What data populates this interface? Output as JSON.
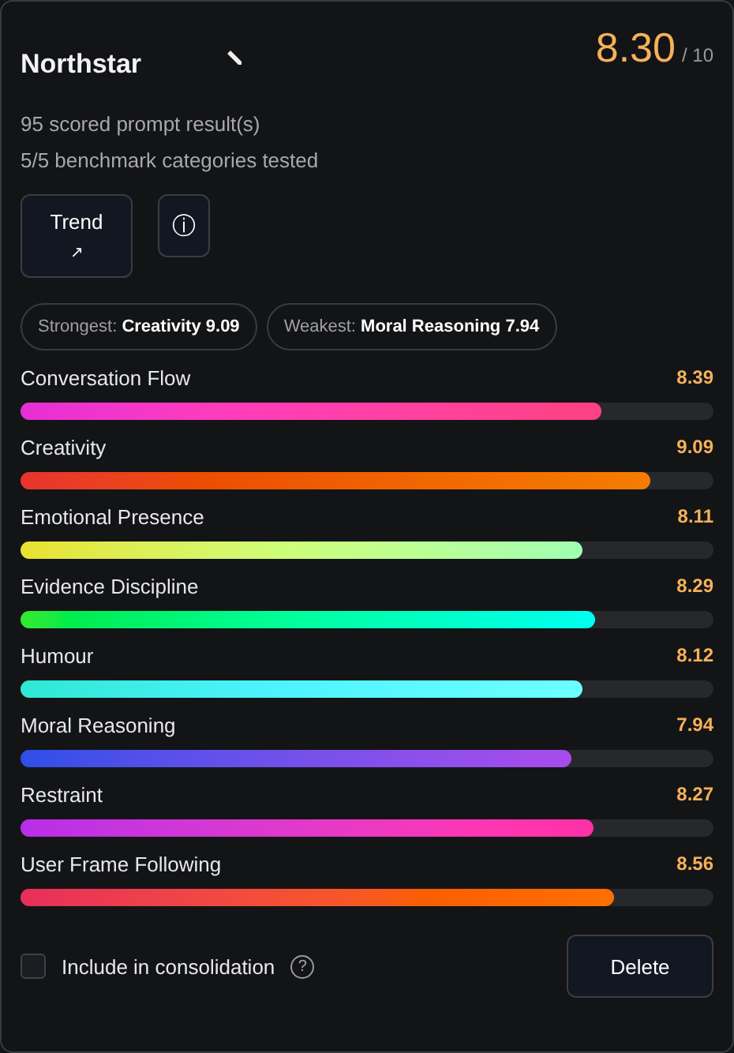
{
  "title": "Northstar",
  "score": {
    "value": "8.30",
    "max": "/ 10"
  },
  "stats": [
    "95 scored prompt result(s)",
    "5/5 benchmark categories tested"
  ],
  "buttons": {
    "trend": {
      "label": "Trend",
      "icon": "↗"
    },
    "info": {
      "icon": "ⓘ"
    }
  },
  "pills": [
    {
      "label": "Strongest:",
      "value": "Creativity 9.09"
    },
    {
      "label": "Weakest:",
      "value": "Moral Reasoning 7.94"
    }
  ],
  "categories": [
    {
      "name": "Conversation Flow",
      "reading": "8.39",
      "level": 0.839,
      "color": "#e62ed6"
    },
    {
      "name": "Creativity",
      "reading": "9.09",
      "level": 0.909,
      "color": "#e8332e"
    },
    {
      "name": "Emotional Presence",
      "reading": "8.11",
      "level": 0.811,
      "color": "#e8e22e"
    },
    {
      "name": "Evidence Discipline",
      "reading": "8.29",
      "level": 0.829,
      "color": "#32e82e"
    },
    {
      "name": "Humour",
      "reading": "8.12",
      "level": 0.812,
      "color": "#2ee8d4"
    },
    {
      "name": "Moral Reasoning",
      "reading": "7.94",
      "level": 0.794,
      "color": "#2e4ee8"
    },
    {
      "name": "Restraint",
      "reading": "8.27",
      "level": 0.827,
      "color": "#b82ee8"
    },
    {
      "name": "User Frame Following",
      "reading": "8.56",
      "level": 0.856,
      "color": "#e82e5a"
    }
  ],
  "consolidation": {
    "label": "Include in consolidation",
    "checked": false,
    "help": "?"
  },
  "delete_button": "Delete"
}
